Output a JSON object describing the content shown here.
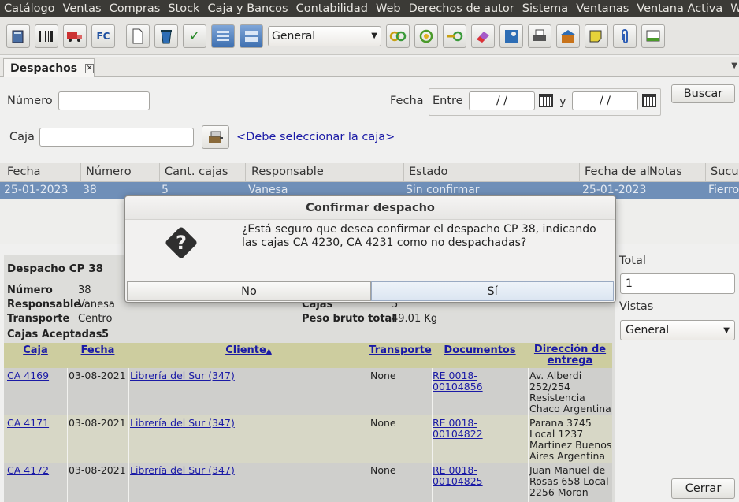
{
  "menu": [
    "Catálogo",
    "Ventas",
    "Compras",
    "Stock",
    "Caja y Bancos",
    "Contabilidad",
    "Web",
    "Derechos de autor",
    "Sistema",
    "Ventanas",
    "Ventana Activa",
    "Window"
  ],
  "toolbar": {
    "fc_label": "FC",
    "view_select": "General"
  },
  "tab": {
    "label": "Despachos"
  },
  "filters": {
    "numero_label": "Número",
    "fecha_label": "Fecha",
    "entre_label": "Entre",
    "y_label": "y",
    "date_from": "/ /",
    "date_to": "/ /",
    "buscar_label": "Buscar",
    "caja_label": "Caja",
    "caja_link": "<Debe seleccionar la caja>"
  },
  "grid": {
    "columns": [
      "Fecha",
      "Número",
      "Cant. cajas",
      "Responsable",
      "Estado",
      "Fecha de al",
      "Notas",
      "Sucur"
    ],
    "row": [
      "25-01-2023",
      "38",
      "5",
      "Vanesa",
      "Sin confirmar",
      "25-01-2023",
      "",
      "Fierro"
    ]
  },
  "detail": {
    "title": "Despacho CP 38",
    "numero_label": "Número",
    "numero_value": "38",
    "responsable_label": "Responsable",
    "responsable_value": "Vanesa",
    "transporte_label": "Transporte",
    "transporte_value": "Centro",
    "cajas_aceptadas_label": "Cajas Aceptadas:",
    "cajas_aceptadas_value": "5",
    "cajas_label": "Cajas",
    "cajas_value": "5",
    "peso_label": "Peso bruto total",
    "peso_value": "49.01 Kg",
    "table": {
      "headers": [
        "Caja",
        "Fecha",
        "Cliente",
        "Transporte",
        "Documentos",
        "Dirección de entrega"
      ],
      "rows": [
        {
          "caja": "CA 4169",
          "fecha": "03-08-2021",
          "cliente": "Librería del Sur (347)",
          "transporte": "None",
          "doc1": "RE 0018-",
          "doc2": "00104856",
          "dir": [
            "Av. Alberdi",
            "252/254",
            "Resistencia",
            "Chaco Argentina"
          ]
        },
        {
          "caja": "CA 4171",
          "fecha": "03-08-2021",
          "cliente": "Librería del Sur (347)",
          "transporte": "None",
          "doc1": "RE 0018-",
          "doc2": "00104822",
          "dir": [
            "Parana 3745",
            "Local 1237",
            "Martinez Buenos",
            "Aires Argentina"
          ]
        },
        {
          "caja": "CA 4172",
          "fecha": "03-08-2021",
          "cliente": "Librería del Sur (347)",
          "transporte": "None",
          "doc1": "RE 0018-",
          "doc2": "00104825",
          "dir": [
            "Juan Manuel de",
            "Rosas 658 Local",
            "2256 Moron",
            ""
          ]
        }
      ]
    }
  },
  "right": {
    "total_label": "Total",
    "total_value": "1",
    "vistas_label": "Vistas",
    "vistas_value": "General",
    "cerrar_label": "Cerrar"
  },
  "dialog": {
    "title": "Confirmar despacho",
    "message_line1": "¿Está seguro que desea confirmar el despacho CP 38, indicando",
    "message_line2": "las cajas CA 4230, CA 4231 como no despachadas?",
    "no_label": "No",
    "yes_label": "Sí"
  }
}
